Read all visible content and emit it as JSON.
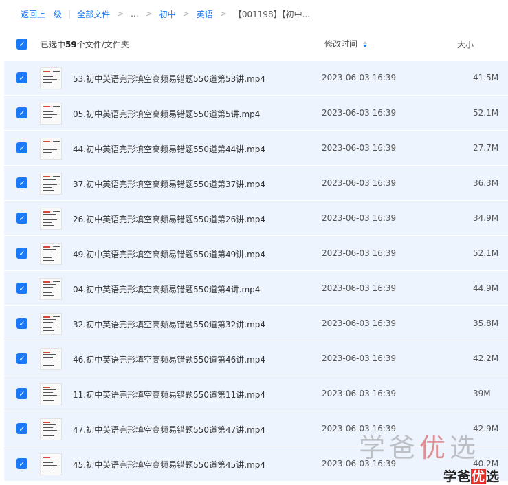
{
  "breadcrumb": {
    "back": "返回上一级",
    "all_files": "全部文件",
    "ellipsis": "...",
    "level1": "初中",
    "level2": "英语",
    "current": "【001198】【初中..."
  },
  "header": {
    "selected_prefix": "已选中",
    "selected_count": "59",
    "selected_suffix": "个文件/文件夹",
    "modified_label": "修改时间",
    "size_label": "大小"
  },
  "colors": {
    "accent": "#1a7af8",
    "row_selected_bg": "#eef4fe"
  },
  "files": [
    {
      "name": "53.初中英语完形填空高频易错题550道第53讲.mp4",
      "time": "2023-06-03 16:39",
      "size": "41.5M"
    },
    {
      "name": "05.初中英语完形填空高频易错题550道第5讲.mp4",
      "time": "2023-06-03 16:39",
      "size": "52.1M"
    },
    {
      "name": "44.初中英语完形填空高频易错题550道第44讲.mp4",
      "time": "2023-06-03 16:39",
      "size": "27.7M"
    },
    {
      "name": "37.初中英语完形填空高频易错题550道第37讲.mp4",
      "time": "2023-06-03 16:39",
      "size": "36.3M"
    },
    {
      "name": "26.初中英语完形填空高频易错题550道第26讲.mp4",
      "time": "2023-06-03 16:39",
      "size": "34.9M"
    },
    {
      "name": "49.初中英语完形填空高频易错题550道第49讲.mp4",
      "time": "2023-06-03 16:39",
      "size": "52.1M"
    },
    {
      "name": "04.初中英语完形填空高频易错题550道第4讲.mp4",
      "time": "2023-06-03 16:39",
      "size": "44.9M"
    },
    {
      "name": "32.初中英语完形填空高频易错题550道第32讲.mp4",
      "time": "2023-06-03 16:39",
      "size": "35.8M"
    },
    {
      "name": "46.初中英语完形填空高频易错题550道第46讲.mp4",
      "time": "2023-06-03 16:39",
      "size": "42.2M"
    },
    {
      "name": "11.初中英语完形填空高频易错题550道第11讲.mp4",
      "time": "2023-06-03 16:39",
      "size": "39M"
    },
    {
      "name": "47.初中英语完形填空高频易错题550道第47讲.mp4",
      "time": "2023-06-03 16:39",
      "size": "42.9M"
    },
    {
      "name": "45.初中英语完形填空高频易错题550道第45讲.mp4",
      "time": "2023-06-03 16:39",
      "size": "40.2M"
    }
  ],
  "watermark": {
    "text_a": "学爸",
    "text_b": "优",
    "text_c": "选"
  }
}
